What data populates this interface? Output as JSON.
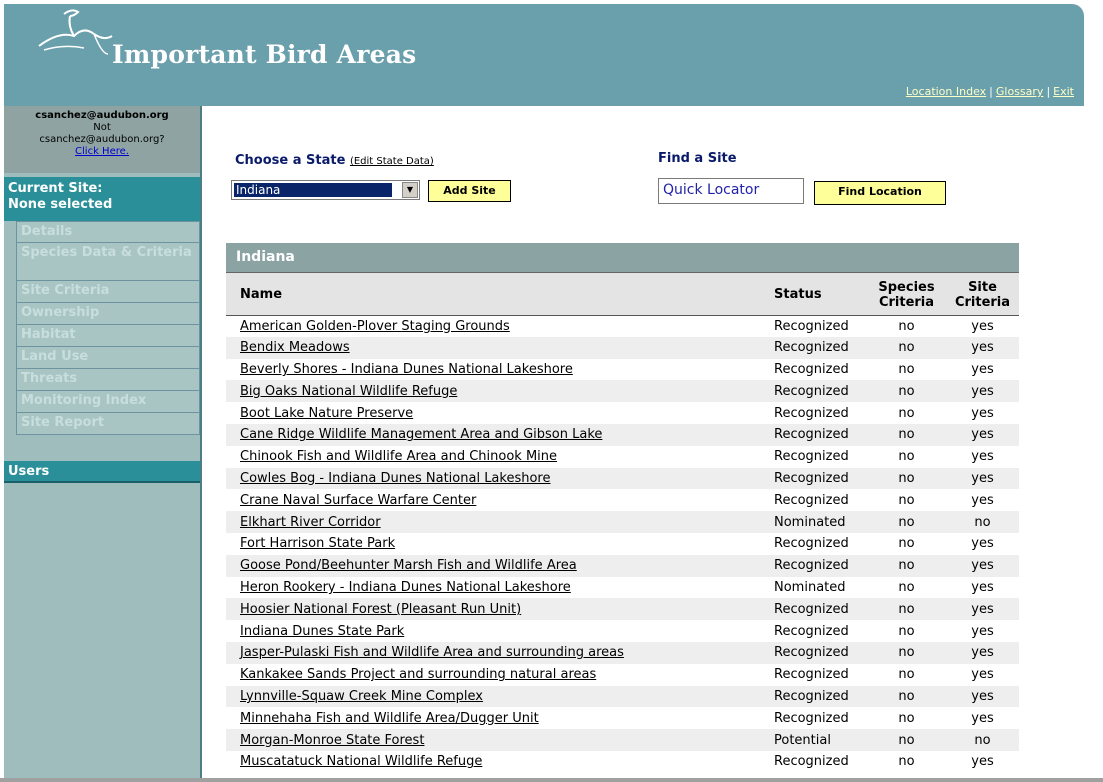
{
  "header": {
    "title": "Important Bird Areas",
    "logo_icon": "heron-icon",
    "links": [
      "Location Index",
      "Glossary",
      "Exit"
    ]
  },
  "sidebar": {
    "user_email": "csanchez@audubon.org",
    "not_prefix": "Not",
    "not_email": "csanchez@audubon.org?",
    "click_here": "Click Here.",
    "current_site_label": "Current Site:",
    "current_site_value": "None selected",
    "items": [
      {
        "label": "Details"
      },
      {
        "label": "Species Data & Criteria"
      },
      {
        "label": "Site Criteria"
      },
      {
        "label": "Ownership"
      },
      {
        "label": "Habitat"
      },
      {
        "label": "Land Use"
      },
      {
        "label": "Threats"
      },
      {
        "label": "Monitoring Index"
      },
      {
        "label": "Site Report"
      }
    ],
    "users_label": "Users"
  },
  "main": {
    "choose_state_label": "Choose a State",
    "edit_state_link": "(Edit State Data)",
    "state_selected": "Indiana",
    "add_site_button": "Add Site",
    "find_site_label": "Find a Site",
    "quick_locator_value": "Quick Locator",
    "find_location_button": "Find Location"
  },
  "table": {
    "title": "Indiana",
    "columns": [
      "Name",
      "Status",
      "Species Criteria",
      "Site Criteria"
    ],
    "rows": [
      {
        "name": "American Golden-Plover Staging Grounds",
        "status": "Recognized",
        "species": "no",
        "site": "yes"
      },
      {
        "name": "Bendix Meadows",
        "status": "Recognized",
        "species": "no",
        "site": "yes"
      },
      {
        "name": "Beverly Shores - Indiana Dunes National Lakeshore",
        "status": "Recognized",
        "species": "no",
        "site": "yes"
      },
      {
        "name": "Big Oaks National Wildlife Refuge",
        "status": "Recognized",
        "species": "no",
        "site": "yes"
      },
      {
        "name": "Boot Lake Nature Preserve",
        "status": "Recognized",
        "species": "no",
        "site": "yes"
      },
      {
        "name": "Cane Ridge Wildlife Management Area and Gibson Lake",
        "status": "Recognized",
        "species": "no",
        "site": "yes"
      },
      {
        "name": "Chinook Fish and Wildlife Area and Chinook Mine",
        "status": "Recognized",
        "species": "no",
        "site": "yes"
      },
      {
        "name": "Cowles Bog - Indiana Dunes National Lakeshore",
        "status": "Recognized",
        "species": "no",
        "site": "yes"
      },
      {
        "name": "Crane Naval Surface Warfare Center",
        "status": "Recognized",
        "species": "no",
        "site": "yes"
      },
      {
        "name": "Elkhart River Corridor",
        "status": "Nominated",
        "species": "no",
        "site": "no"
      },
      {
        "name": "Fort Harrison State Park",
        "status": "Recognized",
        "species": "no",
        "site": "yes"
      },
      {
        "name": "Goose Pond/Beehunter Marsh Fish and Wildlife Area",
        "status": "Recognized",
        "species": "no",
        "site": "yes"
      },
      {
        "name": "Heron Rookery - Indiana Dunes National Lakeshore",
        "status": "Nominated",
        "species": "no",
        "site": "yes"
      },
      {
        "name": "Hoosier National Forest (Pleasant Run Unit)",
        "status": "Recognized",
        "species": "no",
        "site": "yes"
      },
      {
        "name": "Indiana Dunes State Park",
        "status": "Recognized",
        "species": "no",
        "site": "yes"
      },
      {
        "name": "Jasper-Pulaski Fish and Wildlife Area and surrounding areas",
        "status": "Recognized",
        "species": "no",
        "site": "yes"
      },
      {
        "name": "Kankakee Sands Project and surrounding natural areas",
        "status": "Recognized",
        "species": "no",
        "site": "yes"
      },
      {
        "name": "Lynnville-Squaw Creek Mine Complex",
        "status": "Recognized",
        "species": "no",
        "site": "yes"
      },
      {
        "name": "Minnehaha Fish and Wildlife Area/Dugger Unit",
        "status": "Recognized",
        "species": "no",
        "site": "yes"
      },
      {
        "name": "Morgan-Monroe State Forest",
        "status": "Potential",
        "species": "no",
        "site": "no"
      },
      {
        "name": "Muscatatuck National Wildlife Refuge",
        "status": "Recognized",
        "species": "no",
        "site": "yes"
      }
    ]
  }
}
